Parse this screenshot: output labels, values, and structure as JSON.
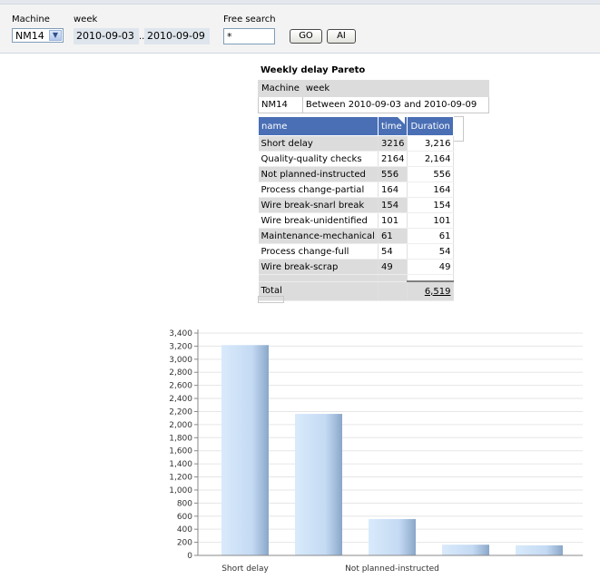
{
  "filters": {
    "machine_label": "Machine",
    "machine_value": "NM14",
    "week_label": "week",
    "week_from": "2010-09-03",
    "week_sep": "..",
    "week_to": "2010-09-09",
    "search_label": "Free search",
    "search_value": "*",
    "go_label": "GO",
    "ai_label": "AI"
  },
  "report": {
    "title": "Weekly delay Pareto",
    "param_headers": [
      "Machine",
      "week"
    ],
    "param_values": [
      "NM14",
      "Between 2010-09-03 and 2010-09-09"
    ]
  },
  "table": {
    "headers": [
      "name",
      "time",
      "Duration"
    ],
    "rows": [
      {
        "name": "Short delay",
        "time": "3216",
        "duration": "3,216"
      },
      {
        "name": "Quality-quality checks",
        "time": "2164",
        "duration": "2,164"
      },
      {
        "name": "Not planned-instructed",
        "time": "556",
        "duration": "556"
      },
      {
        "name": "Process change-partial",
        "time": "164",
        "duration": "164"
      },
      {
        "name": "Wire break-snarl break",
        "time": "154",
        "duration": "154"
      },
      {
        "name": "Wire break-unidentified",
        "time": "101",
        "duration": "101"
      },
      {
        "name": "Maintenance-mechanical",
        "time": "61",
        "duration": "61"
      },
      {
        "name": "Process change-full",
        "time": "54",
        "duration": "54"
      },
      {
        "name": "Wire break-scrap",
        "time": "49",
        "duration": "49"
      }
    ],
    "total_label": "Total",
    "total_value": "6,519"
  },
  "chart_data": {
    "type": "bar",
    "categories": [
      "Short delay",
      "Quality-quality checks",
      "Not planned-instructed",
      "Process change-partial",
      "Wire break-snarl break"
    ],
    "visible_category_labels": [
      "Short delay",
      "",
      "Not planned-instructed",
      "",
      ""
    ],
    "values": [
      3216,
      2164,
      556,
      164,
      154
    ],
    "ylim": [
      0,
      3400
    ],
    "yticks": [
      0,
      200,
      400,
      600,
      800,
      1000,
      1200,
      1400,
      1600,
      1800,
      2000,
      2200,
      2400,
      2600,
      2800,
      3000,
      3200,
      3400
    ],
    "ytick_labels": [
      "0",
      "200",
      "400",
      "600",
      "800",
      "1,000",
      "1,200",
      "1,400",
      "1,600",
      "1,800",
      "2,000",
      "2,200",
      "2,400",
      "2,600",
      "2,800",
      "3,000",
      "3,200",
      "3,400"
    ],
    "grid": true,
    "bar_color": "#cfe3f8"
  }
}
